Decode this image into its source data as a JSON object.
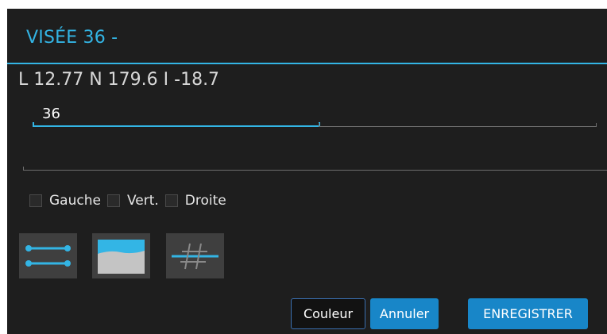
{
  "dialog": {
    "title": "VISÉE 36 -",
    "measure": "L 12.77 N 179.6 I -18.7",
    "fields": {
      "name_value": "36",
      "second_value": "",
      "comment_value": ""
    },
    "checkboxes": [
      {
        "label": "Gauche",
        "checked": false
      },
      {
        "label": "Vert.",
        "checked": false
      },
      {
        "label": "Droite",
        "checked": false
      }
    ],
    "icons": [
      "lines-icon",
      "profile-icon",
      "hash-icon"
    ],
    "buttons": {
      "couleur": "Couleur",
      "annuler": "Annuler",
      "enregistrer": "ENREGISTRER"
    },
    "colors": {
      "accent": "#33b5e5",
      "button": "#1886c8",
      "background": "#1e1e1e"
    }
  }
}
